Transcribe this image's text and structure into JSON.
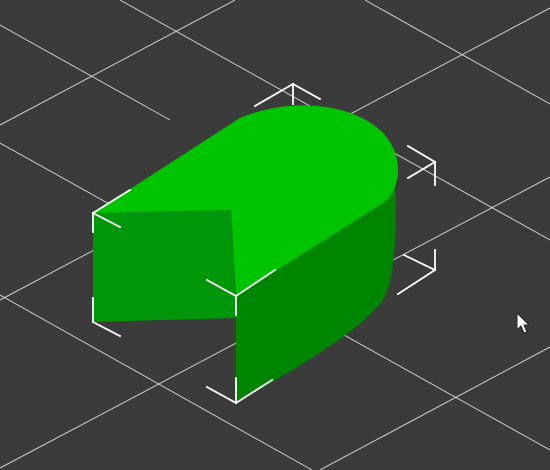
{
  "viewport": {
    "background_color": "#3b3b3b",
    "grid_color": "#e4e4e4"
  },
  "model": {
    "top_face_color": "#00c400",
    "left_face_color": "#00960a",
    "front_face_color": "#008500",
    "selection_box_color": "#ffffff"
  },
  "cursor": {
    "icon": "mouse-pointer-arrow-icon"
  }
}
